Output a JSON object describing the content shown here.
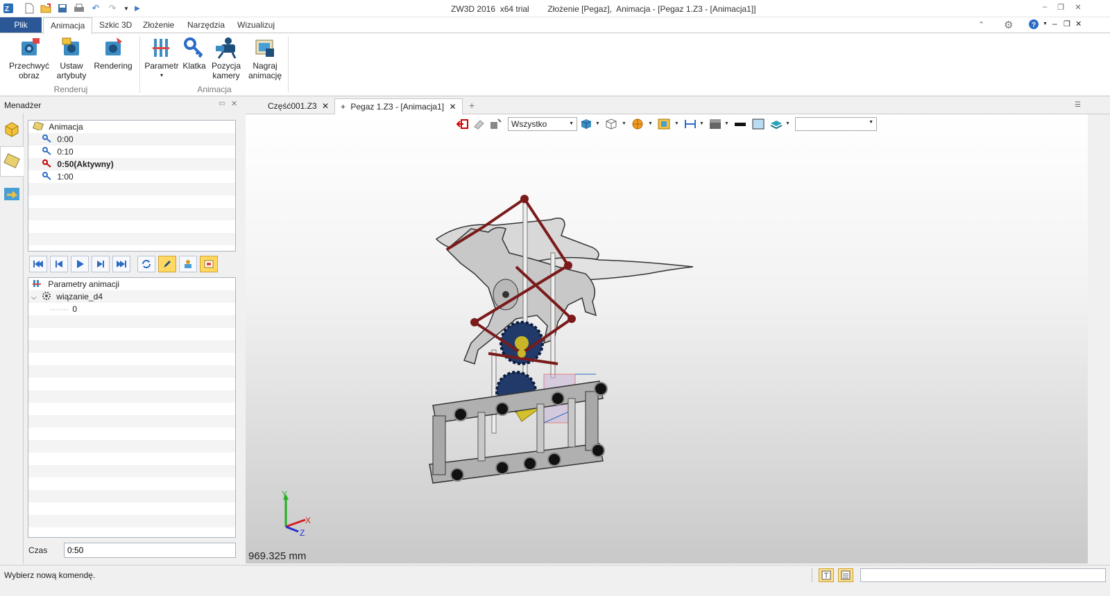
{
  "window": {
    "title": "ZW3D 2016  x64 trial        Złożenie [Pegaz],  Animacja - [Pegaz 1.Z3 - [Animacja1]]"
  },
  "ribbon_tabs": [
    "Plik",
    "Animacja",
    "Szkic 3D",
    "Złożenie",
    "Narzędzia",
    "Wizualizuj"
  ],
  "ribbon": {
    "render_group": {
      "label": "Renderuj",
      "buttons": [
        {
          "line1": "Przechwyć",
          "line2": "obraz"
        },
        {
          "line1": "Ustaw",
          "line2": "artybuty"
        },
        {
          "line1": "Rendering",
          "line2": ""
        }
      ]
    },
    "animation_group": {
      "label": "Animacja",
      "buttons": [
        {
          "line1": "Parametr",
          "line2": "▾"
        },
        {
          "line1": "Klatka",
          "line2": ""
        },
        {
          "line1": "Pozycja",
          "line2": "kamery"
        },
        {
          "line1": "Nagraj",
          "line2": "animację"
        }
      ]
    }
  },
  "manager": {
    "title": "Menadżer",
    "animation_tree": {
      "root": "Animacja",
      "keyframes": [
        {
          "label": "0:00",
          "active": false
        },
        {
          "label": "0:10",
          "active": false
        },
        {
          "label": "0:50(Aktywny)",
          "active": true
        },
        {
          "label": "1:00",
          "active": false
        }
      ]
    },
    "params_tree": {
      "root": "Parametry animacji",
      "constraint": "wiązanie_d4",
      "value": "0"
    },
    "time_label": "Czas",
    "time_value": "0:50"
  },
  "doc_tabs": [
    {
      "label": "Część001.Z3",
      "active": false
    },
    {
      "label": "Pegaz 1.Z3 - [Animacja1]",
      "active": true
    }
  ],
  "viewport": {
    "filter_value": "Wszystko",
    "measure": "969.325 mm",
    "axes": {
      "x": "X",
      "y": "Y",
      "z": "Z"
    }
  },
  "status": {
    "message": "Wybierz nową komendę."
  },
  "colors": {
    "file_tab": "#2b5797",
    "active_keyframe": "#c00000",
    "highlight_button": "#ffd861"
  }
}
